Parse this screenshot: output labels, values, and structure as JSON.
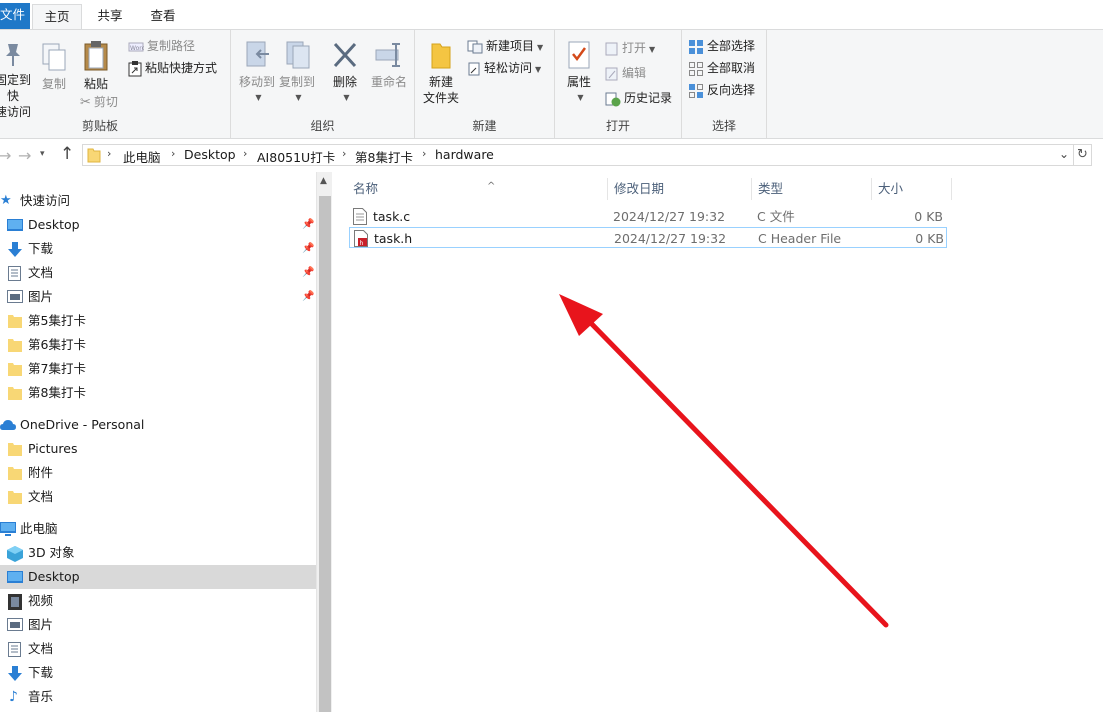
{
  "tabs": {
    "file": "文件",
    "home": "主页",
    "share": "共享",
    "view": "查看"
  },
  "ribbon": {
    "clipboard": {
      "label": "剪贴板",
      "pin_line1": "固定到快",
      "pin_line2": "速访问",
      "copy": "复制",
      "paste": "粘贴",
      "copy_path": "复制路径",
      "paste_shortcut": "粘贴快捷方式",
      "cut": "剪切"
    },
    "organize": {
      "label": "组织",
      "move_to": "移动到",
      "copy_to": "复制到",
      "delete": "删除",
      "rename": "重命名"
    },
    "new": {
      "label": "新建",
      "new_folder_line1": "新建",
      "new_folder_line2": "文件夹",
      "new_item": "新建项目",
      "easy_access": "轻松访问"
    },
    "open": {
      "label": "打开",
      "properties": "属性",
      "open": "打开",
      "edit": "编辑",
      "history": "历史记录"
    },
    "select": {
      "label": "选择",
      "select_all": "全部选择",
      "select_none": "全部取消",
      "invert": "反向选择"
    }
  },
  "address": {
    "crumbs": [
      "此电脑",
      "Desktop",
      "AI8051U打卡",
      "第8集打卡",
      "hardware"
    ]
  },
  "navpane": {
    "quick_access": "快速访问",
    "quick_items": [
      {
        "label": "Desktop",
        "icon": "desktop-icon"
      },
      {
        "label": "下载",
        "icon": "download-icon"
      },
      {
        "label": "文档",
        "icon": "document-icon"
      },
      {
        "label": "图片",
        "icon": "picture-icon"
      },
      {
        "label": "第5集打卡",
        "icon": "folder-icon"
      },
      {
        "label": "第6集打卡",
        "icon": "folder-icon"
      },
      {
        "label": "第7集打卡",
        "icon": "folder-icon"
      },
      {
        "label": "第8集打卡",
        "icon": "folder-icon"
      }
    ],
    "onedrive": "OneDrive - Personal",
    "onedrive_items": [
      "Pictures",
      "附件",
      "文档"
    ],
    "this_pc": "此电脑",
    "pc_items": [
      {
        "label": "3D 对象",
        "icon": "3d-objects-icon"
      },
      {
        "label": "Desktop",
        "icon": "desktop-icon"
      },
      {
        "label": "视频",
        "icon": "video-icon"
      },
      {
        "label": "图片",
        "icon": "picture-icon"
      },
      {
        "label": "文档",
        "icon": "document-icon"
      },
      {
        "label": "下载",
        "icon": "download-icon"
      },
      {
        "label": "音乐",
        "icon": "music-icon"
      }
    ]
  },
  "columns": {
    "name": "名称",
    "date": "修改日期",
    "type": "类型",
    "size": "大小"
  },
  "files": [
    {
      "name": "task.c",
      "date": "2024/12/27 19:32",
      "type": "C 文件",
      "size": "0 KB"
    },
    {
      "name": "task.h",
      "date": "2024/12/27 19:32",
      "type": "C Header File",
      "size": "0 KB"
    }
  ],
  "colors": {
    "accent": "#1f78c8",
    "annotation_arrow": "#e8141c",
    "selection_border": "#99d1ff"
  }
}
